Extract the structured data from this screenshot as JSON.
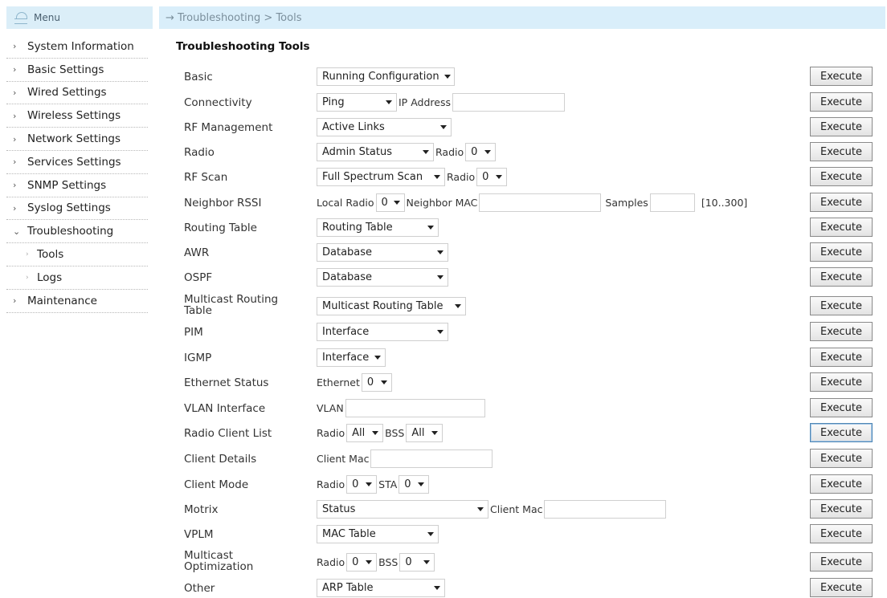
{
  "menu": {
    "title": "Menu"
  },
  "sidebar": {
    "items": [
      {
        "label": "System Information",
        "arrow": "›"
      },
      {
        "label": "Basic Settings",
        "arrow": "›"
      },
      {
        "label": "Wired Settings",
        "arrow": "›"
      },
      {
        "label": "Wireless Settings",
        "arrow": "›"
      },
      {
        "label": "Network Settings",
        "arrow": "›"
      },
      {
        "label": "Services Settings",
        "arrow": "›"
      },
      {
        "label": "SNMP Settings",
        "arrow": "›"
      },
      {
        "label": "Syslog Settings",
        "arrow": "›"
      },
      {
        "label": "Troubleshooting",
        "arrow": "⌄"
      },
      {
        "label": "Tools",
        "arrow": "›"
      },
      {
        "label": "Logs",
        "arrow": "›"
      },
      {
        "label": "Maintenance",
        "arrow": "›"
      }
    ]
  },
  "breadcrumb": "→ Troubleshooting > Tools",
  "page_title": "Troubleshooting Tools",
  "execute_label": "Execute",
  "rows": {
    "basic": {
      "label": "Basic",
      "sel1": "Running Configuration"
    },
    "connectivity": {
      "label": "Connectivity",
      "sel1": "Ping",
      "text1": "IP Address"
    },
    "rf_management": {
      "label": "RF Management",
      "sel1": "Active Links"
    },
    "radio": {
      "label": "Radio",
      "sel1": "Admin Status",
      "text1": "Radio",
      "sel2": "0"
    },
    "rf_scan": {
      "label": "RF Scan",
      "sel1": "Full Spectrum Scan",
      "text1": "Radio",
      "sel2": "0"
    },
    "neighbor_rssi": {
      "label": "Neighbor RSSI",
      "text1": "Local Radio",
      "sel1": "0",
      "text2": "Neighbor MAC",
      "text3": "Samples",
      "range": "[10..300]"
    },
    "routing_table": {
      "label": "Routing Table",
      "sel1": "Routing Table"
    },
    "awr": {
      "label": "AWR",
      "sel1": "Database"
    },
    "ospf": {
      "label": "OSPF",
      "sel1": "Database"
    },
    "multicast_routing": {
      "label": "Multicast Routing Table",
      "sel1": "Multicast Routing Table"
    },
    "pim": {
      "label": "PIM",
      "sel1": "Interface"
    },
    "igmp": {
      "label": "IGMP",
      "sel1": "Interface"
    },
    "ethernet_status": {
      "label": "Ethernet Status",
      "text1": "Ethernet",
      "sel1": "0"
    },
    "vlan_interface": {
      "label": "VLAN Interface",
      "text1": "VLAN"
    },
    "radio_client_list": {
      "label": "Radio Client List",
      "text1": "Radio",
      "sel1": "All",
      "text2": "BSS",
      "sel2": "All"
    },
    "client_details": {
      "label": "Client Details",
      "text1": "Client Mac"
    },
    "client_mode": {
      "label": "Client Mode",
      "text1": "Radio",
      "sel1": "0",
      "text2": "STA",
      "sel2": "0"
    },
    "motrix": {
      "label": "Motrix",
      "sel1": "Status",
      "text1": "Client Mac"
    },
    "vplm": {
      "label": "VPLM",
      "sel1": "MAC Table"
    },
    "multicast_optimization": {
      "label": "Multicast Optimization",
      "text1": "Radio",
      "sel1": "0",
      "text2": "BSS",
      "sel2": "0"
    },
    "other": {
      "label": "Other",
      "sel1": "ARP Table"
    }
  },
  "colors": {
    "header_bg": "#d9eefa",
    "button_border": "#8a8a8a",
    "focus_border": "#4f87b5"
  },
  "icons": {
    "menu": "network-tree-icon",
    "caret": "chevron-down-icon"
  }
}
